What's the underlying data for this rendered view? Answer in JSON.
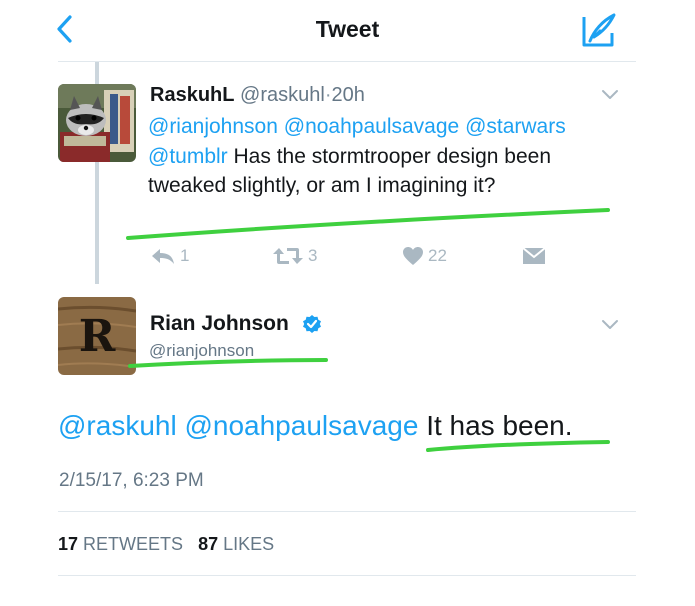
{
  "header": {
    "title": "Tweet",
    "back_icon": "chevron-left-icon",
    "compose_icon": "compose-quill-icon",
    "accent": "#1da1f2"
  },
  "reply_tweet": {
    "name": "RaskuhL",
    "handle": "@raskuhl",
    "separator": "·",
    "time": "20h",
    "mention_1": "@rianjohnson",
    "mention_2": "@noahpaulsavage",
    "mention_3": "@starwars",
    "mention_4": "@tumblr",
    "text": "Has the stormtrooper design been tweaked slightly, or am I imagining it?",
    "actions": {
      "reply_count": "1",
      "retweet_count": "3",
      "like_count": "22"
    }
  },
  "main_tweet": {
    "avatar_letter": "R",
    "name": "Rian Johnson",
    "handle": "@rianjohnson",
    "mention_1": "@raskuhl",
    "mention_2": "@noahpaulsavage",
    "text": "It has been.",
    "date": "2/15/17, 6:23 PM",
    "retweets_count": "17",
    "retweets_label": "RETWEETS",
    "likes_count": "87",
    "likes_label": "LIKES"
  },
  "annotation_color": "#3fd03f"
}
